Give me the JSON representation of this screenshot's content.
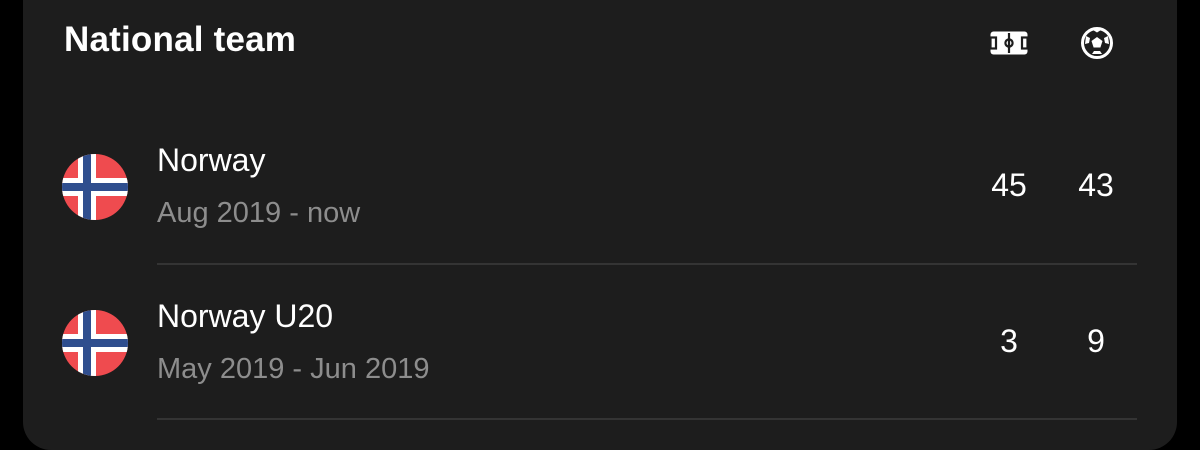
{
  "section": {
    "title": "National team",
    "column_icons": [
      "matches-played-icon",
      "goals-icon"
    ]
  },
  "teams": [
    {
      "name": "Norway",
      "period": "Aug 2019 - now",
      "matches": "45",
      "goals": "43",
      "flag": "norway-flag-icon"
    },
    {
      "name": "Norway U20",
      "period": "May 2019 - Jun 2019",
      "matches": "3",
      "goals": "9",
      "flag": "norway-flag-icon"
    }
  ],
  "colors": {
    "background": "#000000",
    "card": "#1d1d1d",
    "text_primary": "#ffffff",
    "text_secondary": "#8d8d8d",
    "divider": "#343434",
    "flag_red": "#ef4b4f",
    "flag_blue": "#2f4e8e",
    "flag_white": "#ffffff"
  }
}
